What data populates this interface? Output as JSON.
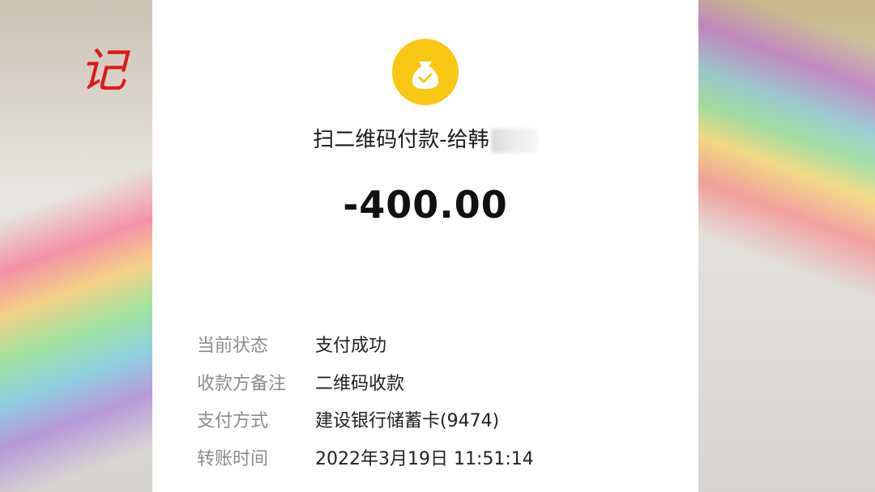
{
  "logo": {
    "text": "记"
  },
  "header": {
    "title": "扫二维码付款-给韩",
    "amount": "-400.00"
  },
  "details": [
    {
      "label": "当前状态",
      "value": "支付成功"
    },
    {
      "label": "收款方备注",
      "value": "二维码收款"
    },
    {
      "label": "支付方式",
      "value": "建设银行储蓄卡(9474)"
    },
    {
      "label": "转账时间",
      "value": "2022年3月19日 11:51:14"
    }
  ],
  "colors": {
    "icon_bg": "#f7c713",
    "logo": "#e01818"
  },
  "icons": {
    "header_icon": "money-bag-check-icon"
  }
}
